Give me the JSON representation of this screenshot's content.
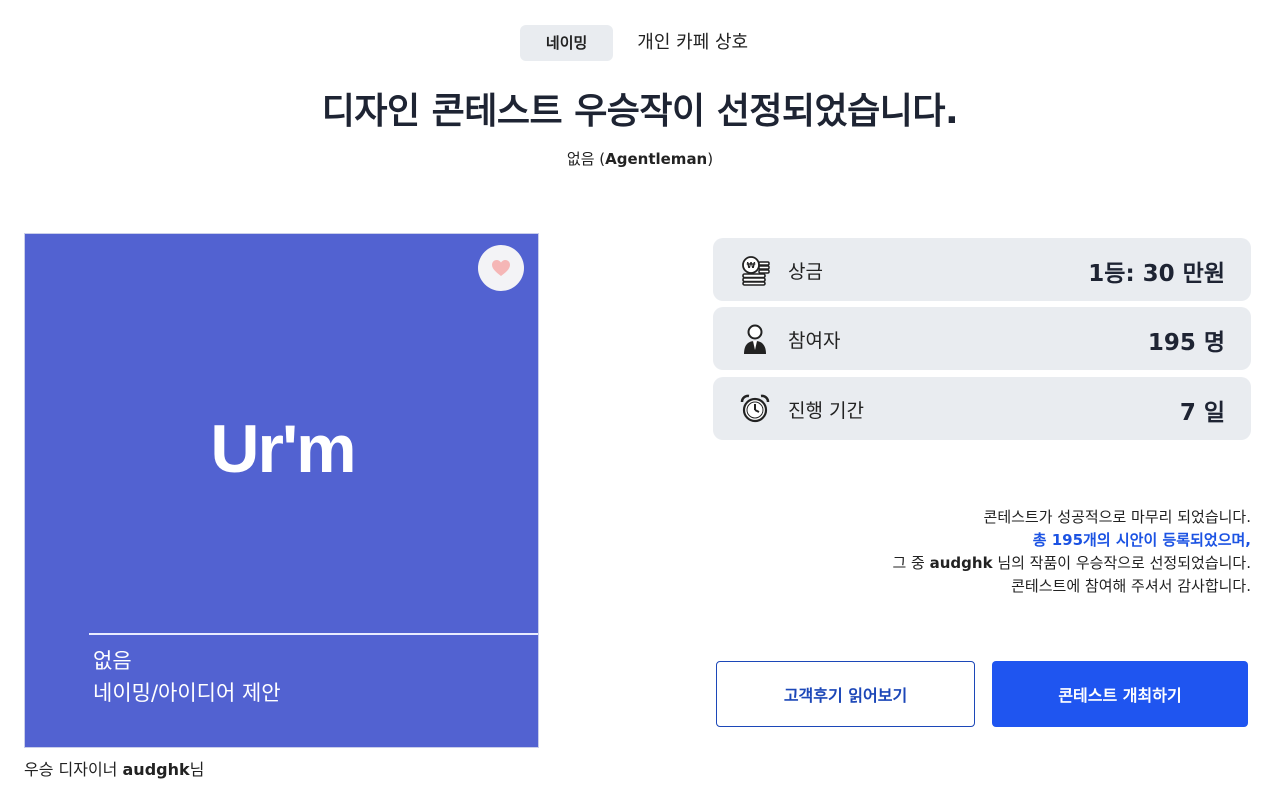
{
  "tags": {
    "category": "네이밍",
    "subcategory": "개인 카페 상호"
  },
  "title": "디자인 콘테스트 우승작이 선정되었습니다.",
  "subtitle": {
    "prefix": "없음 (",
    "brand": "Agentleman",
    "suffix": ")"
  },
  "card": {
    "logo": "Ur'm",
    "label1": "없음",
    "label2": "네이밍/아이디어 제안",
    "background_color": "#5262d1",
    "heart_icon": "heart-icon"
  },
  "winner": {
    "prefix": "우승 디자이너 ",
    "name": "audghk",
    "suffix": "님"
  },
  "stats": [
    {
      "icon": "coins-icon",
      "label": "상금",
      "value": "1등: 30 만원"
    },
    {
      "icon": "person-icon",
      "label": "참여자",
      "value": "195 명"
    },
    {
      "icon": "alarm-clock-icon",
      "label": "진행 기간",
      "value": "7 일"
    }
  ],
  "message": {
    "line1": "콘테스트가 성공적으로 마무리 되었습니다.",
    "line2": "총 195개의 시안이 등록되었으며,",
    "line3_prefix": "그 중 ",
    "line3_name": "audghk",
    "line3_suffix": " 님의 작품이 우승작으로 선정되었습니다.",
    "line4": "콘테스트에 참여해 주셔서 감사합니다."
  },
  "buttons": {
    "reviews": "고객후기 읽어보기",
    "host": "콘테스트 개최하기"
  },
  "colors": {
    "accent": "#1f55f0",
    "highlight": "#1c53e3",
    "card": "#5262d1"
  }
}
